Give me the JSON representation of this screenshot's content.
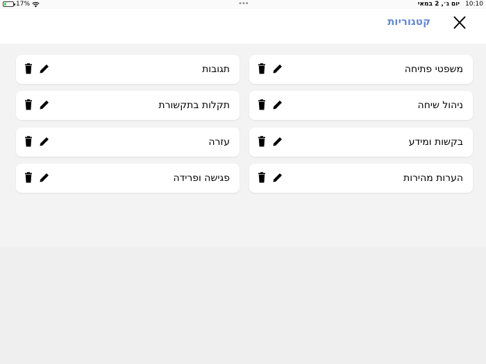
{
  "status_bar": {
    "battery_percent": "17%",
    "time": "10:10",
    "date": "יום ג׳, 2 במאי",
    "battery_fraction": 0.17,
    "multitask_dots": "•••"
  },
  "header": {
    "title": "קטגוריות",
    "close_icon": "close-icon"
  },
  "colors": {
    "accent": "#6688cc",
    "background": "#f3f3f3",
    "card": "#ffffff"
  },
  "categories": [
    {
      "label": "משפטי פתיחה"
    },
    {
      "label": "תגובות"
    },
    {
      "label": "ניהול שיחה"
    },
    {
      "label": "תקלות בתקשורת"
    },
    {
      "label": "בקשות ומידע"
    },
    {
      "label": "עזרה"
    },
    {
      "label": "הערות מהירות"
    },
    {
      "label": "פגישה ופרידה"
    }
  ],
  "card_icons": [
    "edit-icon",
    "trash-icon"
  ]
}
